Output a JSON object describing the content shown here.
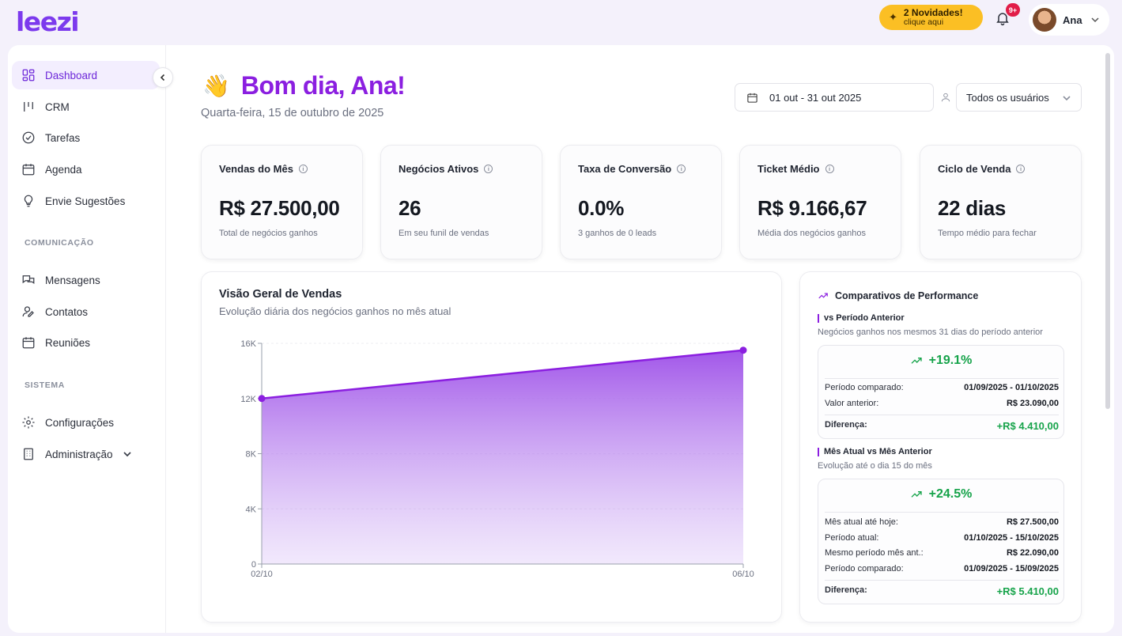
{
  "brand": {
    "logo": "leezi",
    "accent": "#8b1fe0"
  },
  "topbar": {
    "news_title": "2 Novidades!",
    "news_sub": "clique aqui",
    "notif_badge": "9+",
    "user_name": "Ana"
  },
  "sidebar": {
    "items": [
      {
        "label": "Dashboard",
        "icon": "grid-icon",
        "active": true
      },
      {
        "label": "CRM",
        "icon": "kanban-icon"
      },
      {
        "label": "Tarefas",
        "icon": "check-circle-icon"
      },
      {
        "label": "Agenda",
        "icon": "calendar-icon"
      },
      {
        "label": "Envie Sugestões",
        "icon": "lightbulb-icon"
      }
    ],
    "section_comm": "COMUNICAÇÃO",
    "comm_items": [
      {
        "label": "Mensagens",
        "icon": "messages-icon"
      },
      {
        "label": "Contatos",
        "icon": "contact-icon"
      },
      {
        "label": "Reuniões",
        "icon": "calendar-icon"
      }
    ],
    "section_sys": "SISTEMA",
    "sys_items": [
      {
        "label": "Configurações",
        "icon": "gear-icon"
      },
      {
        "label": "Administração",
        "icon": "building-icon"
      }
    ]
  },
  "header": {
    "greeting": "Bom dia, Ana!",
    "wave": "👋",
    "date": "Quarta-feira, 15 de outubro de 2025",
    "date_range": "01 out - 31 out 2025",
    "user_filter": "Todos os usuários"
  },
  "kpis": [
    {
      "title": "Vendas do Mês",
      "value": "R$ 27.500,00",
      "sub": "Total de negócios ganhos"
    },
    {
      "title": "Negócios Ativos",
      "value": "26",
      "sub": "Em seu funil de vendas"
    },
    {
      "title": "Taxa de Conversão",
      "value": "0.0%",
      "sub": "3 ganhos de 0 leads"
    },
    {
      "title": "Ticket Médio",
      "value": "R$ 9.166,67",
      "sub": "Média dos negócios ganhos"
    },
    {
      "title": "Ciclo de Venda",
      "value": "22 dias",
      "sub": "Tempo médio para fechar"
    }
  ],
  "chart": {
    "title": "Visão Geral de Vendas",
    "subtitle": "Evolução diária dos negócios ganhos no mês atual"
  },
  "chart_data": {
    "type": "area",
    "x": [
      "02/10",
      "06/10"
    ],
    "values": [
      12000,
      15500
    ],
    "ylim": [
      0,
      16000
    ],
    "yticks": [
      0,
      4000,
      8000,
      12000,
      16000
    ],
    "ytick_labels": [
      "0",
      "4K",
      "8K",
      "12K",
      "16K"
    ],
    "color": "#8b1fe0",
    "grid": true
  },
  "performance": {
    "title": "Comparativos de Performance",
    "sec1_head": "vs Período Anterior",
    "sec1_desc": "Negócios ganhos nos mesmos 31 dias do período anterior",
    "sec1_pct": "+19.1%",
    "sec1_rows": [
      {
        "label": "Período comparado:",
        "value": "01/09/2025 - 01/10/2025"
      },
      {
        "label": "Valor anterior:",
        "value": "R$ 23.090,00"
      }
    ],
    "sec1_diff_label": "Diferença:",
    "sec1_diff_value": "+R$ 4.410,00",
    "sec2_head": "Mês Atual vs Mês Anterior",
    "sec2_desc": "Evolução até o dia 15 do mês",
    "sec2_pct": "+24.5%",
    "sec2_rows": [
      {
        "label": "Mês atual até hoje:",
        "value": "R$ 27.500,00"
      },
      {
        "label": "Período atual:",
        "value": "01/10/2025 - 15/10/2025"
      },
      {
        "label": "Mesmo período mês ant.:",
        "value": "R$ 22.090,00"
      },
      {
        "label": "Período comparado:",
        "value": "01/09/2025 - 15/09/2025"
      }
    ],
    "sec2_diff_label": "Diferença:",
    "sec2_diff_value": "+R$ 5.410,00",
    "positive_color": "#16a34a"
  }
}
